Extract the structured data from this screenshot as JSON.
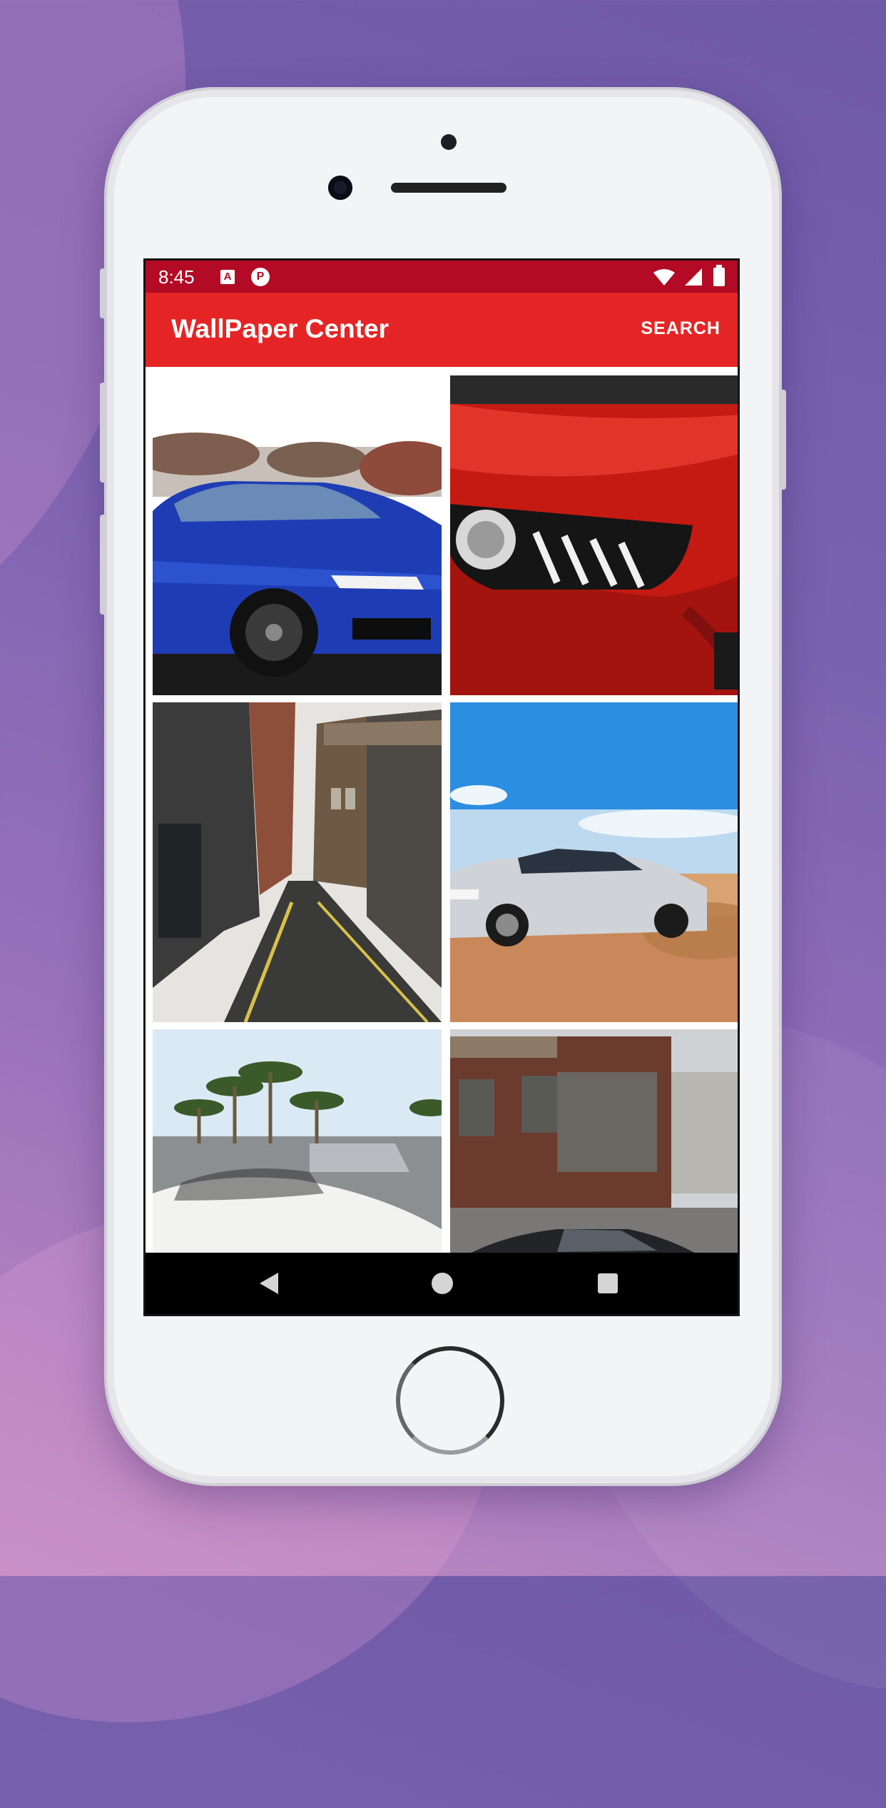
{
  "status_bar": {
    "time": "8:45",
    "notification_icons": [
      "a-icon",
      "p-icon"
    ],
    "system_icons": [
      "wifi-icon",
      "signal-icon",
      "battery-icon"
    ]
  },
  "app_bar": {
    "title": "WallPaper Center",
    "search_label": "SEARCH",
    "color": "#e52525",
    "status_color": "#b30b25"
  },
  "wallpapers": [
    {
      "subject": "blue sedan"
    },
    {
      "subject": "red car headlight"
    },
    {
      "subject": "city alley"
    },
    {
      "subject": "white sedan drifting"
    },
    {
      "subject": "white convertible"
    },
    {
      "subject": "black sedan"
    }
  ],
  "nav_bar": {
    "buttons": [
      "back-icon",
      "home-icon",
      "recents-icon"
    ]
  }
}
